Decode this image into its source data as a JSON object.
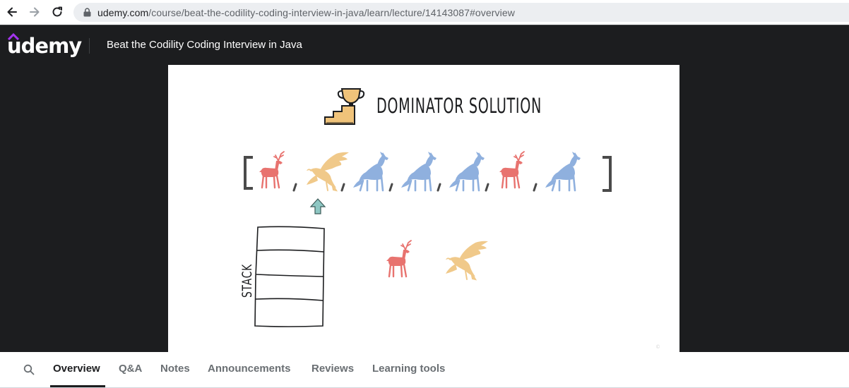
{
  "browser": {
    "url_domain": "udemy.com",
    "url_path": "/course/beat-the-codility-coding-interview-in-java/learn/lecture/14143087#overview"
  },
  "header": {
    "logo_text": "udemy",
    "course_title": "Beat the Codility Coding Interview in Java"
  },
  "slide": {
    "title": "DOMINATOR SOLUTION",
    "stack_label": "STACK",
    "array_sequence": [
      "deer",
      "eagle",
      "wolf",
      "wolf",
      "wolf",
      "deer",
      "wolf"
    ],
    "pointer_index": 1,
    "stack_slots": 4,
    "candidates": [
      "deer",
      "eagle"
    ],
    "colors": {
      "deer": "#e8736f",
      "eagle": "#f0c98a",
      "wolf": "#8fb0de",
      "arrow": "#8ec7c3"
    }
  },
  "tabs": [
    {
      "label": "Overview",
      "active": true
    },
    {
      "label": "Q&A",
      "active": false
    },
    {
      "label": "Notes",
      "active": false
    },
    {
      "label": "Announcements",
      "active": false
    },
    {
      "label": "Reviews",
      "active": false
    },
    {
      "label": "Learning tools",
      "active": false
    }
  ],
  "colors": {
    "udemy_purple": "#a435f0",
    "header_bg": "#1c1d1f"
  }
}
